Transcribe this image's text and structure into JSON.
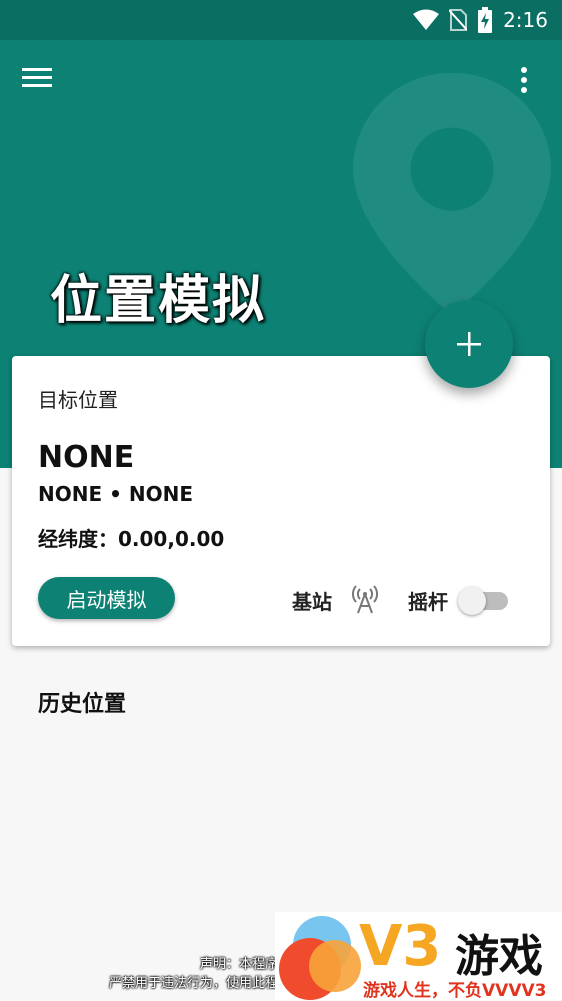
{
  "status_bar": {
    "time": "2:16"
  },
  "header": {
    "title": "位置模拟"
  },
  "card": {
    "label": "目标位置",
    "place_name": "NONE",
    "place_sub": "NONE • NONE",
    "coords": "经纬度：0.00,0.00",
    "start_button": "启动模拟",
    "station_label": "基站",
    "joystick_label": "摇杆",
    "joystick_enabled": false
  },
  "history": {
    "title": "历史位置"
  },
  "disclaimer": {
    "line1": "声明：本程序仅供",
    "line2": "严禁用于违法行为，使用此程序所"
  },
  "watermark": {
    "brand": "V3",
    "brand_cn": "游戏",
    "slogan": "游戏人生，不负VVVV3"
  },
  "colors": {
    "primary": "#0d8274",
    "status_bar": "#0a6e63",
    "toggle_off": "#bdbdbd"
  },
  "icons": [
    "wifi-icon",
    "no-sim-icon",
    "battery-charging-icon",
    "menu-icon",
    "more-vert-icon",
    "add-icon",
    "cell-tower-icon"
  ]
}
